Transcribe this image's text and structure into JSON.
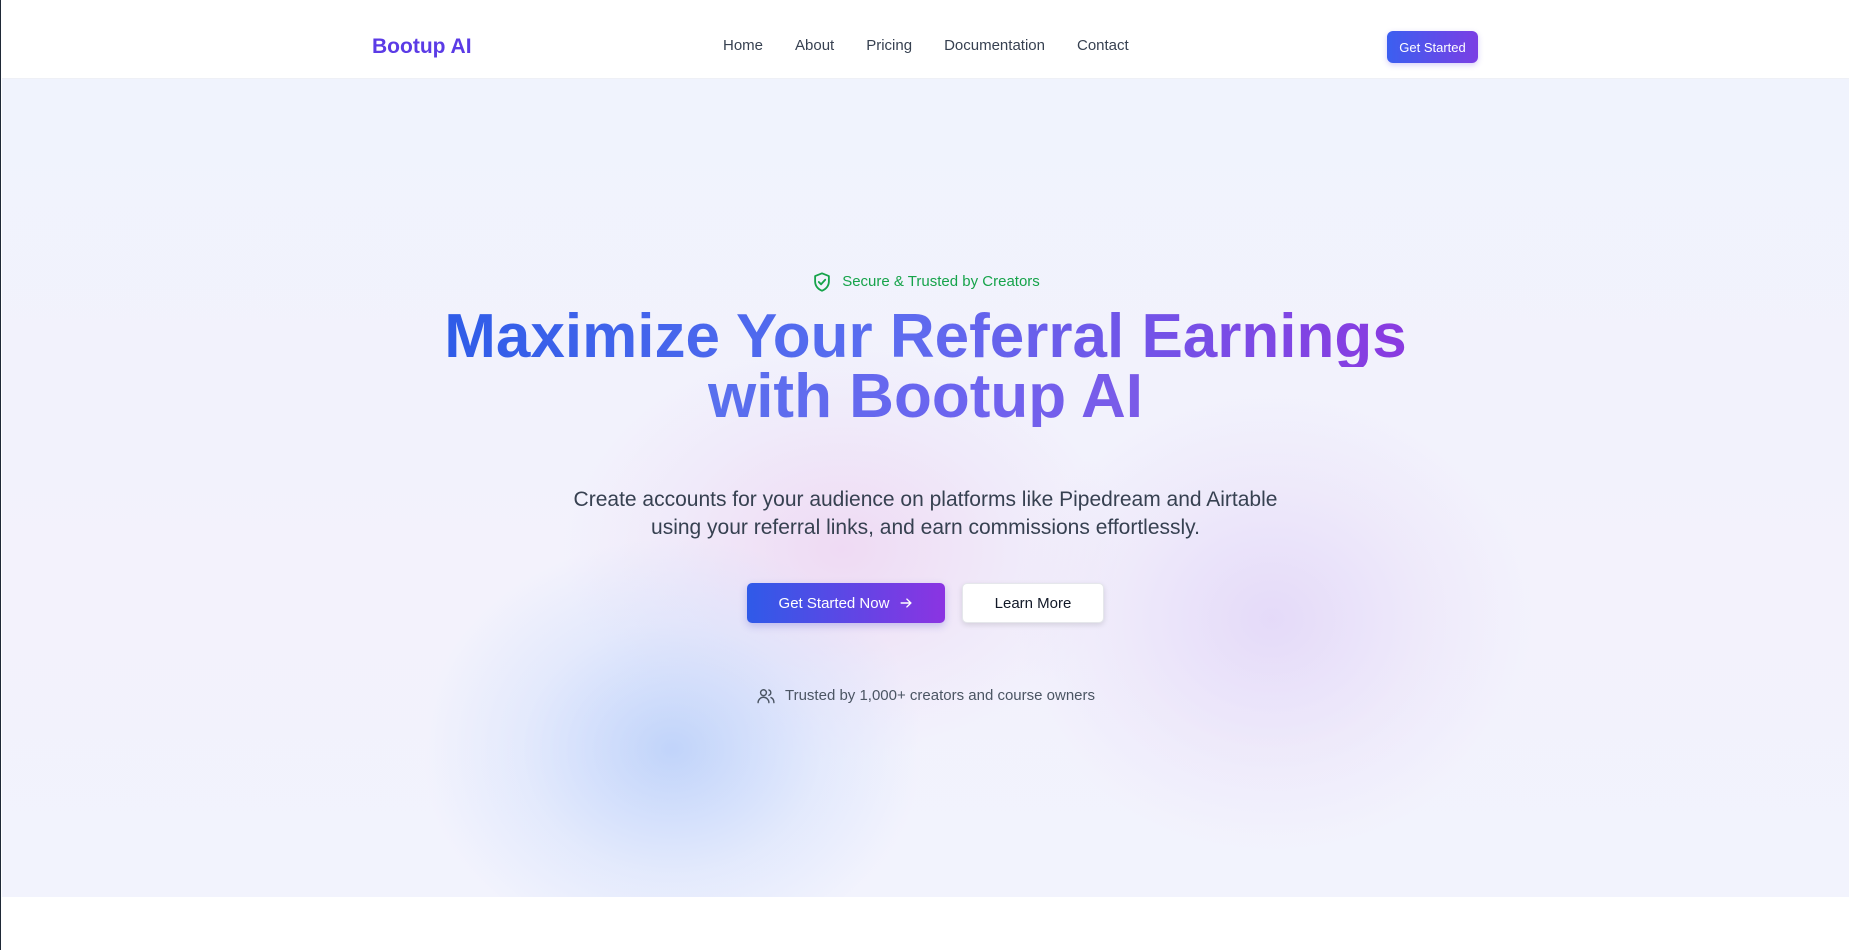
{
  "header": {
    "brand": "Bootup AI",
    "nav": [
      "Home",
      "About",
      "Pricing",
      "Documentation",
      "Contact"
    ],
    "cta_label": "Get Started"
  },
  "hero": {
    "badge_text": "Secure & Trusted by Creators",
    "headline_line1": "Maximize Your Referral Earnings",
    "headline_line2": "with Bootup AI",
    "subtext_line1": "Create accounts for your audience on platforms like Pipedream and Airtable",
    "subtext_line2": "using your referral links, and earn commissions effortlessly.",
    "primary_button": "Get Started Now",
    "secondary_button": "Learn More",
    "trust_text": "Trusted by 1,000+ creators and course owners"
  },
  "colors": {
    "brand": "#5b3be6",
    "gradient_start": "#2f5ae8",
    "gradient_end": "#8b34e2",
    "badge_green": "#16a34a"
  },
  "icons": {
    "badge": "shield-check-icon",
    "primary_button": "arrow-right-icon",
    "trust": "users-icon"
  }
}
